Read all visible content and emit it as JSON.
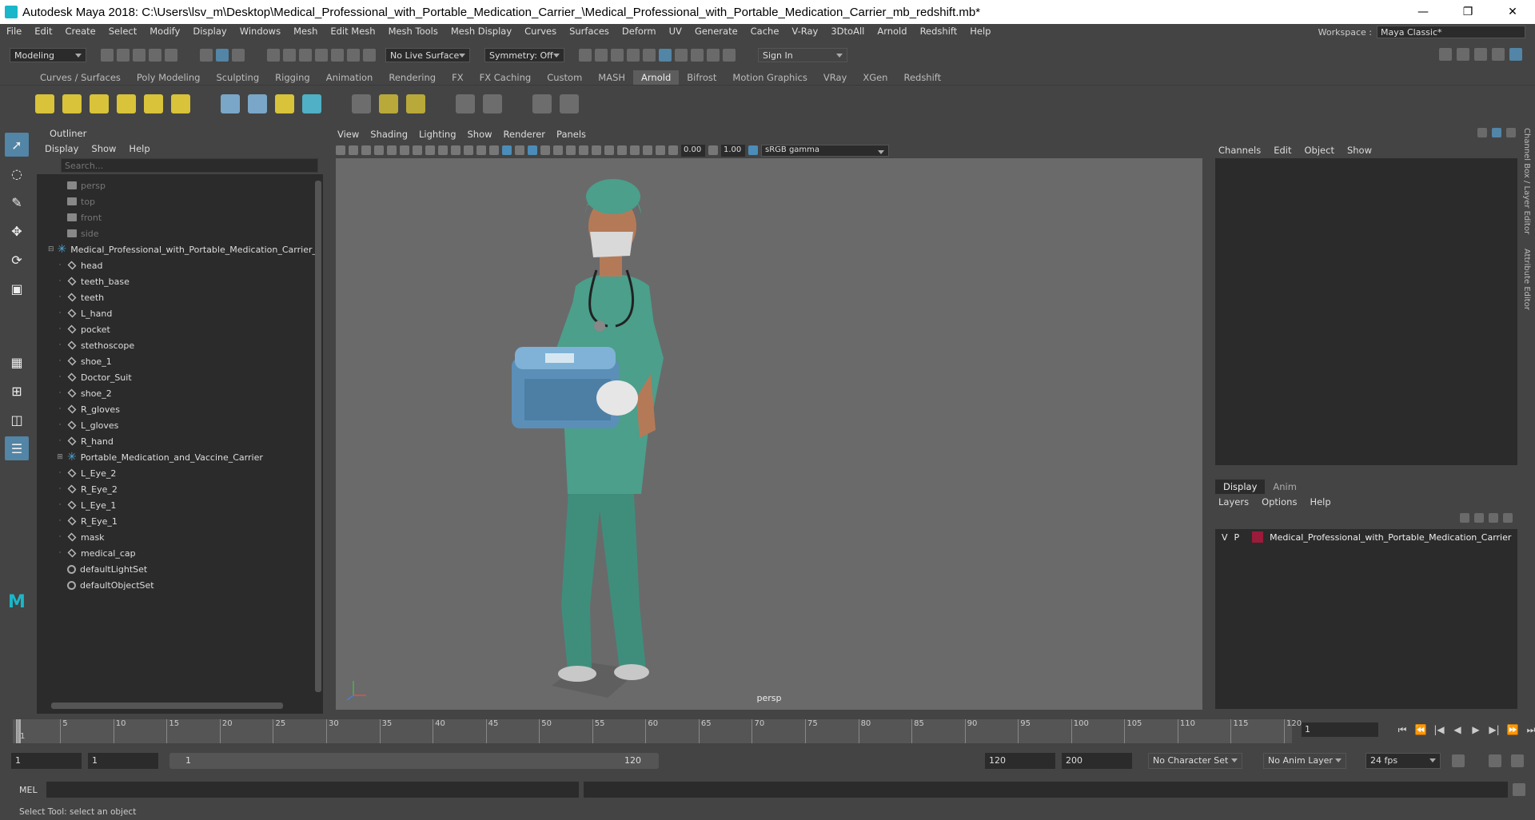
{
  "window": {
    "title": "Autodesk Maya 2018: C:\\Users\\lsv_m\\Desktop\\Medical_Professional_with_Portable_Medication_Carrier_\\Medical_Professional_with_Portable_Medication_Carrier_mb_redshift.mb*",
    "minimize": "—",
    "maximize": "❐",
    "close": "✕"
  },
  "menubar": [
    "File",
    "Edit",
    "Create",
    "Select",
    "Modify",
    "Display",
    "Windows",
    "Mesh",
    "Edit Mesh",
    "Mesh Tools",
    "Mesh Display",
    "Curves",
    "Surfaces",
    "Deform",
    "UV",
    "Generate",
    "Cache",
    "V-Ray",
    "3DtoAll",
    "Arnold",
    "Redshift",
    "Help"
  ],
  "workspace": {
    "label": "Workspace :",
    "value": "Maya Classic*"
  },
  "statusline": {
    "mode": "Modeling",
    "live_surface": "No Live Surface",
    "symmetry": "Symmetry: Off",
    "sign_in": "Sign In"
  },
  "shelf_tabs": [
    "Curves / Surfaces",
    "Poly Modeling",
    "Sculpting",
    "Rigging",
    "Animation",
    "Rendering",
    "FX",
    "FX Caching",
    "Custom",
    "MASH",
    "Arnold",
    "Bifrost",
    "Motion Graphics",
    "VRay",
    "XGen",
    "Redshift"
  ],
  "shelf_active": "Arnold",
  "outliner": {
    "title": "Outliner",
    "menu": [
      "Display",
      "Show",
      "Help"
    ],
    "search_placeholder": "Search...",
    "items": [
      {
        "label": "persp",
        "type": "camera",
        "dim": true
      },
      {
        "label": "top",
        "type": "camera",
        "dim": true
      },
      {
        "label": "front",
        "type": "camera",
        "dim": true
      },
      {
        "label": "side",
        "type": "camera",
        "dim": true
      },
      {
        "label": "Medical_Professional_with_Portable_Medication_Carrier_",
        "type": "group",
        "expanded": true
      },
      {
        "label": "head",
        "type": "mesh"
      },
      {
        "label": "teeth_base",
        "type": "mesh"
      },
      {
        "label": "teeth",
        "type": "mesh"
      },
      {
        "label": "L_hand",
        "type": "mesh"
      },
      {
        "label": "pocket",
        "type": "mesh"
      },
      {
        "label": "stethoscope",
        "type": "mesh"
      },
      {
        "label": "shoe_1",
        "type": "mesh"
      },
      {
        "label": "Doctor_Suit",
        "type": "mesh"
      },
      {
        "label": "shoe_2",
        "type": "mesh"
      },
      {
        "label": "R_gloves",
        "type": "mesh"
      },
      {
        "label": "L_gloves",
        "type": "mesh"
      },
      {
        "label": "R_hand",
        "type": "mesh"
      },
      {
        "label": "Portable_Medication_and_Vaccine_Carrier",
        "type": "group",
        "expanded": false
      },
      {
        "label": "L_Eye_2",
        "type": "mesh"
      },
      {
        "label": "R_Eye_2",
        "type": "mesh"
      },
      {
        "label": "L_Eye_1",
        "type": "mesh"
      },
      {
        "label": "R_Eye_1",
        "type": "mesh"
      },
      {
        "label": "mask",
        "type": "mesh"
      },
      {
        "label": "medical_cap",
        "type": "mesh"
      },
      {
        "label": "defaultLightSet",
        "type": "set"
      },
      {
        "label": "defaultObjectSet",
        "type": "set"
      }
    ]
  },
  "viewport": {
    "menu": [
      "View",
      "Shading",
      "Lighting",
      "Show",
      "Renderer",
      "Panels"
    ],
    "exposure": "0.00",
    "gamma": "1.00",
    "color_space": "sRGB gamma",
    "camera": "persp"
  },
  "channel_box": {
    "menu": [
      "Channels",
      "Edit",
      "Object",
      "Show"
    ]
  },
  "side_tabs": [
    "Channel Box / Layer Editor",
    "Attribute Editor"
  ],
  "layer_editor": {
    "tabs": [
      "Display",
      "Anim"
    ],
    "menu": [
      "Layers",
      "Options",
      "Help"
    ],
    "layers": [
      {
        "v": "V",
        "p": "P",
        "name": "Medical_Professional_with_Portable_Medication_Carrier",
        "color": "#9b1b3a"
      }
    ]
  },
  "timeline": {
    "ticks": [
      "1",
      "5",
      "10",
      "15",
      "20",
      "25",
      "30",
      "35",
      "40",
      "45",
      "50",
      "55",
      "60",
      "65",
      "70",
      "75",
      "80",
      "85",
      "90",
      "95",
      "100",
      "105",
      "110",
      "115",
      "120"
    ],
    "current_frame": "1"
  },
  "range": {
    "start": "1",
    "anim_start": "1",
    "slider_start": "1",
    "slider_end": "120",
    "end": "120",
    "anim_end": "200",
    "character_set": "No Character Set",
    "anim_layer": "No Anim Layer",
    "fps": "24 fps"
  },
  "command_line": {
    "label": "MEL"
  },
  "help_line": "Select Tool: select an object"
}
